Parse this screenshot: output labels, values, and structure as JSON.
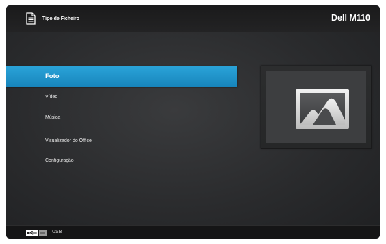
{
  "header": {
    "title": "Tipo de Ficheiro",
    "model": "Dell M110",
    "icon": "document-icon"
  },
  "menu": {
    "items": [
      {
        "label": "Foto",
        "selected": true
      },
      {
        "label": "Vídeo",
        "selected": false
      },
      {
        "label": "Música",
        "selected": false
      },
      {
        "label": "Visualizador do Office",
        "selected": false
      },
      {
        "label": "Configuração",
        "selected": false
      }
    ]
  },
  "preview": {
    "icon": "photo-icon"
  },
  "footer": {
    "source_label": "USB",
    "icon": "usb-icon"
  },
  "colors": {
    "accent": "#1e93cc",
    "background": "#2a2b2d",
    "bar": "#1a1a1b"
  }
}
